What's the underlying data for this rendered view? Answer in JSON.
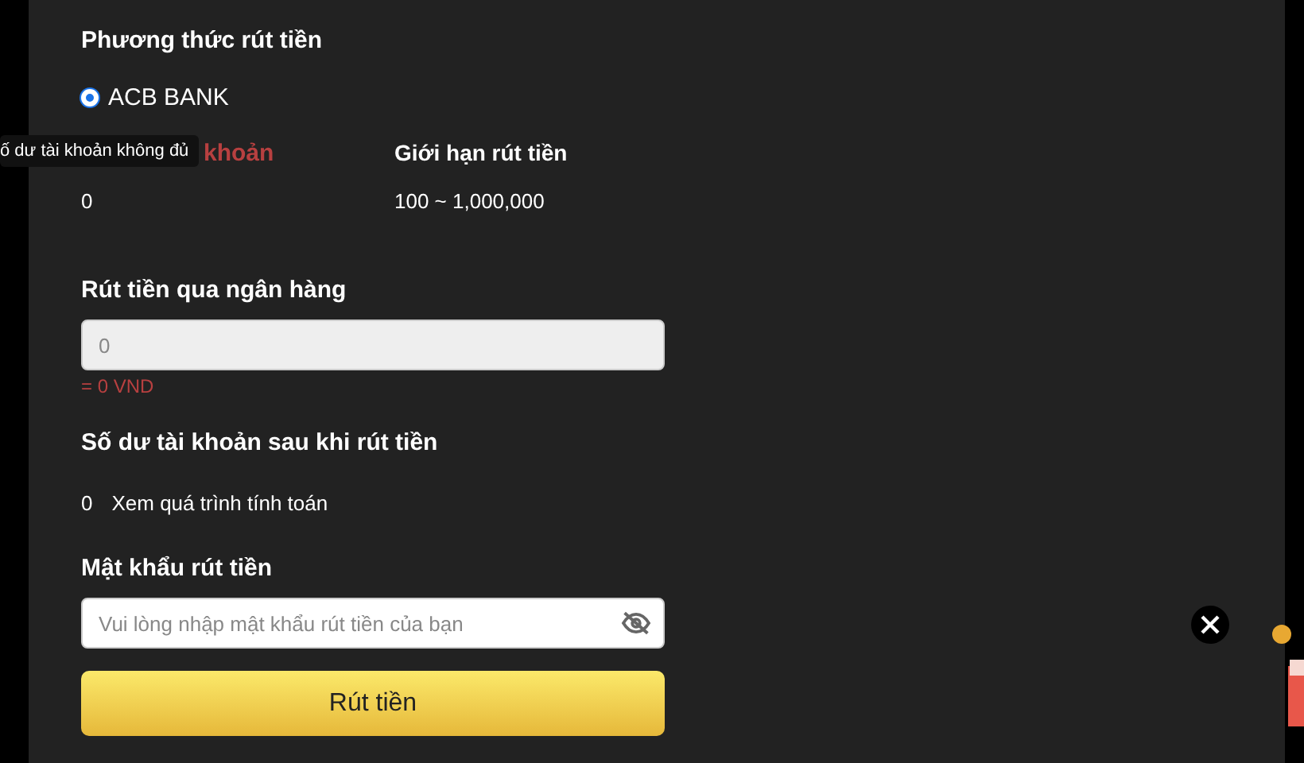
{
  "method": {
    "title": "Phương thức rút tiền",
    "options": [
      {
        "label": "ACB BANK",
        "selected": true
      }
    ]
  },
  "balance": {
    "label": "khoản",
    "value": "0",
    "tooltip": "ố dư tài khoản không đủ"
  },
  "limit": {
    "label": "Giới hạn rút tiền",
    "value": "100 ~ 1,000,000"
  },
  "amount": {
    "title": "Rút tiền qua ngân hàng",
    "placeholder": "0",
    "conversion": "= 0 VND"
  },
  "after": {
    "title": "Số dư tài khoản sau khi rút tiền",
    "value": "0",
    "link": "Xem quá trình tính toán"
  },
  "password": {
    "title": "Mật khẩu rút tiền",
    "placeholder": "Vui lòng nhập mật khẩu rút tiền của bạn"
  },
  "submit": "Rút tiền"
}
